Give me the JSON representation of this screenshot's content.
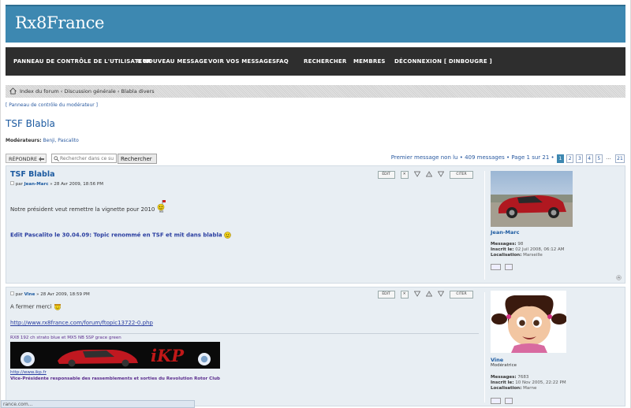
{
  "site": {
    "title": "Rx8France"
  },
  "nav": {
    "items": [
      "PANNEAU DE CONTRÔLE DE L'UTILISATEUR",
      "0 NOUVEAU MESSAGE",
      "VOIR VOS MESSAGES",
      "FAQ",
      "RECHERCHER",
      "MEMBRES",
      "DÉCONNEXION [ DINBOUGRE ]"
    ]
  },
  "breadcrumb": {
    "items": [
      "Index du forum",
      "Discussion générale",
      "Blabla divers"
    ],
    "separator": "‹"
  },
  "moderator_panel": "[ Panneau de contrôle du modérateur ]",
  "topic": {
    "title": "TSF Blabla",
    "moderators_label": "Modérateurs:",
    "moderators": "Benji, Pascalito"
  },
  "toolbar": {
    "reply_label": "RÉPONDRE",
    "search_placeholder": "Rechercher dans ce su",
    "search_button": "Rechercher",
    "first_unread": "Premier message non lu",
    "summary": "• 409 messages • Page 1 sur 21 •",
    "pages": [
      "1",
      "2",
      "3",
      "4",
      "5",
      "...",
      "21"
    ],
    "current_page": "1"
  },
  "posts": [
    {
      "title": "TSF Blabla",
      "meta_prefix": "par",
      "author": "Jean-Marc",
      "meta_date": "» 28 Avr 2009, 18:56 PM",
      "body": "Notre président veut remettre la vignette pour 2010",
      "edit_note": "Edit Pascalito le 30.04.09: Topic renommé en TSF et mit dans blabla",
      "actions": {
        "edit": "ÉDIT",
        "quote": "CITER"
      },
      "profile": {
        "name": "Jean-Marc",
        "rank": "",
        "messages_label": "Messages:",
        "messages": "98",
        "joined_label": "Inscrit le:",
        "joined": "02 Juil 2008, 06:12 AM",
        "location_label": "Localisation:",
        "location": "Marseille"
      }
    },
    {
      "title": "",
      "meta_prefix": "par",
      "author": "Vine",
      "meta_date": "» 28 Avr 2009, 18:59 PM",
      "body": "A fermer merci",
      "link": "http://www.rx8france.com/forum/ftopic13722-0.php",
      "signature": {
        "line1": "RX8 192 ch strato blue et MX5 NB SSP grace green",
        "banner_text": "iKP",
        "url": "http://www.ikp.fr",
        "role": "Vice-Présidente responsable des rassemblements et sorties du Revolution Rotor Club"
      },
      "actions": {
        "edit": "ÉDIT",
        "quote": "CITER"
      },
      "profile": {
        "name": "Vine",
        "rank": "Modératrice",
        "messages_label": "Messages:",
        "messages": "7683",
        "joined_label": "Inscrit le:",
        "joined": "10 Nov 2005, 22:22 PM",
        "location_label": "Localisation:",
        "location": "Marne"
      }
    }
  ],
  "status_bar": "rance.com...",
  "colors": {
    "header": "#3d88b1",
    "nav": "#2e2e2e",
    "post_bg": "#e8eef3",
    "link": "#1c5aa0"
  }
}
